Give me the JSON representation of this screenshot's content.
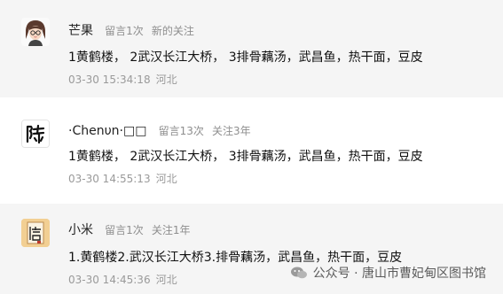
{
  "comments": [
    {
      "nickname": "芒果",
      "msg_count": "留言1次",
      "relation": "新的关注",
      "text": "1黄鹤楼， 2武汉长江大桥， 3排骨藕汤，武昌鱼，热干面，豆皮",
      "time": "03-30 15:34:18",
      "location": "河北",
      "avatar_icon": "cartoon-girl-avatar"
    },
    {
      "nickname": "·Chenυn·□□",
      "msg_count": "留言13次",
      "relation": "关注3年",
      "text": "1黄鹤楼， 2武汉长江大桥， 3排骨藕汤，武昌鱼，热干面，豆皮",
      "time": "03-30 14:55:13",
      "location": "河北",
      "avatar_icon": "calligraphy-chen-avatar",
      "avatar_char": "陈"
    },
    {
      "nickname": "小米",
      "msg_count": "留言1次",
      "relation": "关注1年",
      "text": "1.黄鹤楼2.武汉长江大桥3.排骨藕汤，武昌鱼，热干面，豆皮",
      "time": "03-30 14:45:36",
      "location": "河北",
      "avatar_icon": "wu-character-avatar",
      "avatar_char": "悟"
    }
  ],
  "watermark": {
    "text": "公众号 · 唐山市曹妃甸区图书馆",
    "icon": "wechat-official-account-icon"
  },
  "colors": {
    "highlight_bg": "#f5f5f5",
    "meta_text": "#8e8e8e",
    "avatar_orange": "#f2cf93"
  }
}
